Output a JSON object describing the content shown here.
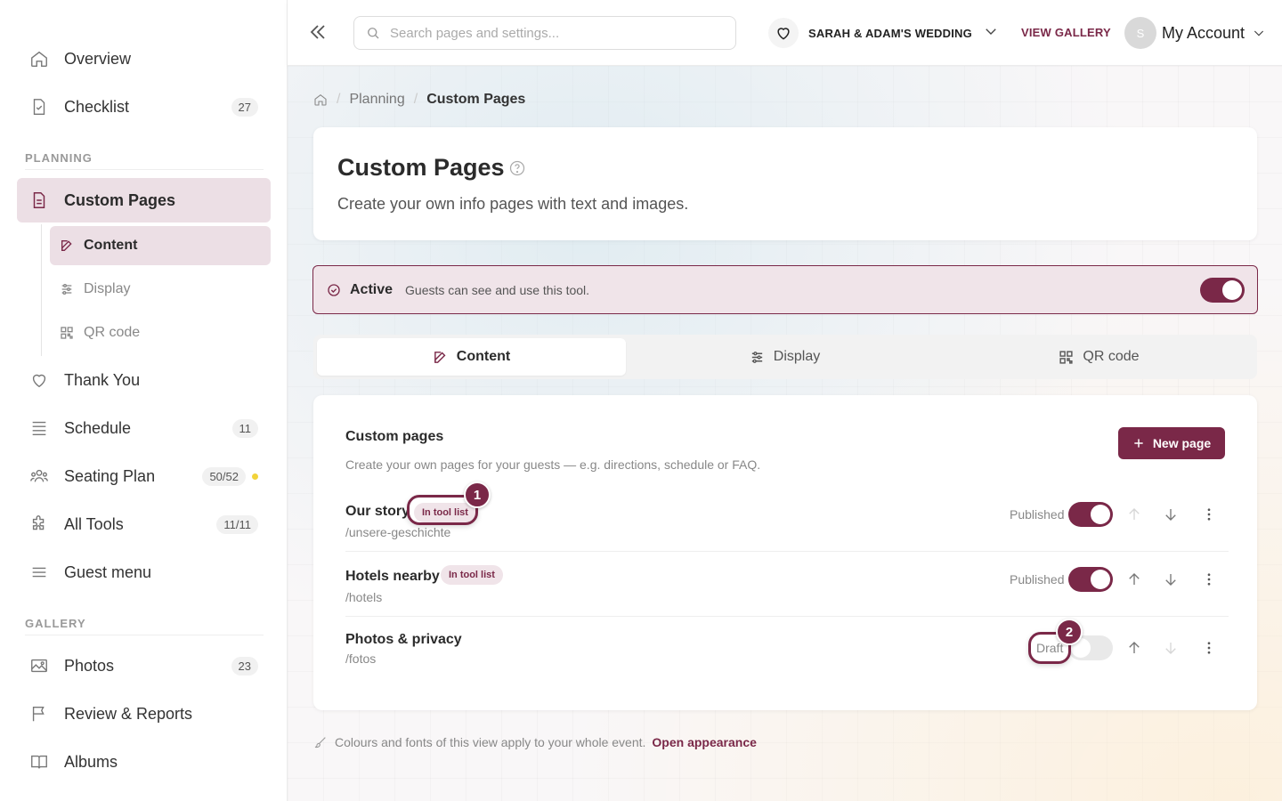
{
  "sidebar": {
    "overview": "Overview",
    "checklist": {
      "label": "Checklist",
      "badge": "27"
    },
    "section_planning": "PLANNING",
    "custom_pages": "Custom Pages",
    "sub_content": "Content",
    "sub_display": "Display",
    "sub_qr": "QR code",
    "thank_you": "Thank You",
    "schedule": {
      "label": "Schedule",
      "badge": "11"
    },
    "seating": {
      "label": "Seating Plan",
      "badge": "50/52"
    },
    "all_tools": {
      "label": "All Tools",
      "badge": "11/11"
    },
    "guest_menu": "Guest menu",
    "section_gallery": "GALLERY",
    "photos": {
      "label": "Photos",
      "badge": "23"
    },
    "review": "Review & Reports",
    "albums": "Albums"
  },
  "topbar": {
    "search_placeholder": "Search pages and settings...",
    "event_name": "SARAH & ADAM'S WEDDING",
    "view_gallery": "VIEW GALLERY",
    "avatar_initial": "S",
    "account": "My Account"
  },
  "breadcrumb": {
    "planning": "Planning",
    "current": "Custom Pages"
  },
  "header": {
    "title": "Custom Pages",
    "subtitle": "Create your own info pages with text and images."
  },
  "active_bar": {
    "label": "Active",
    "description": "Guests can see and use this tool.",
    "enabled": true
  },
  "tabs": {
    "content": "Content",
    "display": "Display",
    "qr": "QR code"
  },
  "list": {
    "title": "Custom pages",
    "subtitle": "Create your own pages for your guests — e.g. directions, schedule or FAQ.",
    "new_button": "New page",
    "pages": [
      {
        "title": "Our story",
        "slug": "/unsere-geschichte",
        "pill": "In tool list",
        "status": "Published",
        "published": true
      },
      {
        "title": "Hotels nearby",
        "slug": "/hotels",
        "pill": "In tool list",
        "status": "Published",
        "published": true
      },
      {
        "title": "Photos & privacy",
        "slug": "/fotos",
        "pill": "",
        "status": "Draft",
        "published": false
      }
    ]
  },
  "callouts": [
    "1",
    "2"
  ],
  "footer": {
    "note": "Colours and fonts of this view apply to your whole event.",
    "link": "Open appearance"
  },
  "colors": {
    "accent": "#7a2848",
    "accent_soft": "#ecdfe5"
  }
}
